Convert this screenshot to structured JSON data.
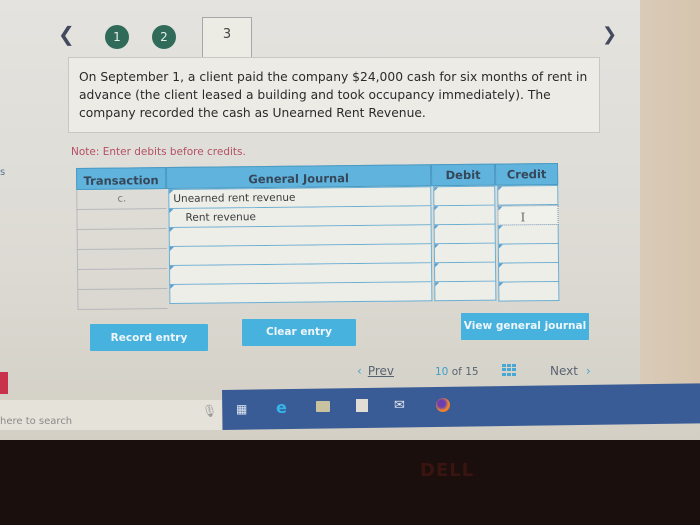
{
  "navigation": {
    "back_icon": "chevron-left",
    "forward_icon": "chevron-right",
    "steps": [
      {
        "label": "1",
        "state": "completed"
      },
      {
        "label": "2",
        "state": "completed"
      },
      {
        "label": "3",
        "state": "active"
      }
    ]
  },
  "question": {
    "text": "On September 1, a client paid the company $24,000 cash for six months of rent in advance (the client leased a building and took occupancy immediately). The company recorded the cash as Unearned Rent Revenue."
  },
  "note": "Note: Enter debits before credits.",
  "journal": {
    "headers": {
      "transaction": "Transaction",
      "general_journal": "General Journal",
      "debit": "Debit",
      "credit": "Credit"
    },
    "rows": [
      {
        "transaction": "c.",
        "account": "Unearned rent revenue",
        "debit": "",
        "credit": ""
      },
      {
        "transaction": "",
        "account": "Rent revenue",
        "debit": "",
        "credit": ""
      },
      {
        "transaction": "",
        "account": "",
        "debit": "",
        "credit": ""
      },
      {
        "transaction": "",
        "account": "",
        "debit": "",
        "credit": ""
      },
      {
        "transaction": "",
        "account": "",
        "debit": "",
        "credit": ""
      },
      {
        "transaction": "",
        "account": "",
        "debit": "",
        "credit": ""
      }
    ]
  },
  "buttons": {
    "record_entry": "Record entry",
    "clear_entry": "Clear entry",
    "view_general_journal": "View general journal"
  },
  "pager": {
    "prev_label": "Prev",
    "current": "10",
    "of_label": "of",
    "total": "15",
    "next_label": "Next",
    "prev_icon": "‹",
    "next_icon": "›"
  },
  "taskbar": {
    "search_placeholder": "here to search",
    "icons": [
      "microphone",
      "task-view",
      "edge",
      "file-explorer",
      "store",
      "mail",
      "firefox"
    ]
  },
  "brand": "DELL",
  "side_text": "s",
  "colors": {
    "accent": "#48b2df",
    "step_done": "#2f6b58",
    "note": "#b45066",
    "taskbar": "#3a5c96"
  }
}
